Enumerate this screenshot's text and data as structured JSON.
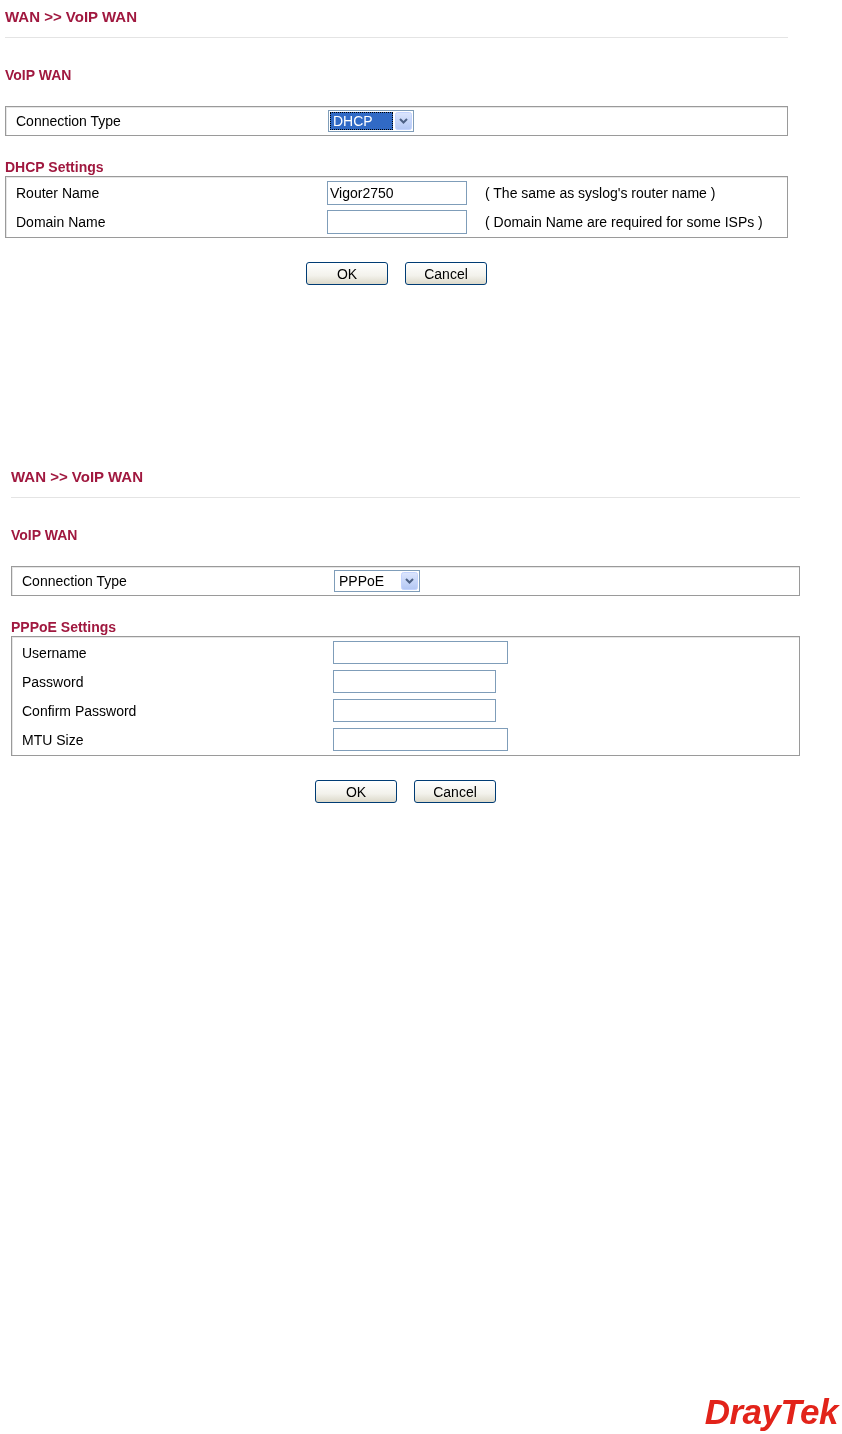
{
  "panels": [
    {
      "breadcrumb": "WAN >> VoIP WAN",
      "section_title": "VoIP WAN",
      "connection_type": {
        "label": "Connection Type",
        "value": "DHCP",
        "focused": true
      },
      "settings": {
        "title": "DHCP Settings",
        "fields": [
          {
            "kind": "text",
            "label": "Router Name",
            "value": "Vigor2750",
            "hint": "( The same as syslog's router name )"
          },
          {
            "kind": "text",
            "label": "Domain Name",
            "hint": "( Domain Name are required for some ISPs )"
          }
        ]
      },
      "buttons": [
        "OK",
        "Cancel"
      ]
    },
    {
      "breadcrumb": "WAN >> VoIP WAN",
      "section_title": "VoIP WAN",
      "connection_type": {
        "label": "Connection Type",
        "value": "PPPoE",
        "focused": false
      },
      "settings": {
        "title": "PPPoE Settings",
        "fields": [
          {
            "kind": "text",
            "label": "Username"
          },
          {
            "kind": "password",
            "label": "Password"
          },
          {
            "kind": "password",
            "label": "Confirm Password"
          },
          {
            "kind": "text",
            "label": "MTU Size"
          }
        ]
      },
      "buttons": [
        "OK",
        "Cancel"
      ]
    }
  ],
  "logo": "DrayTek"
}
